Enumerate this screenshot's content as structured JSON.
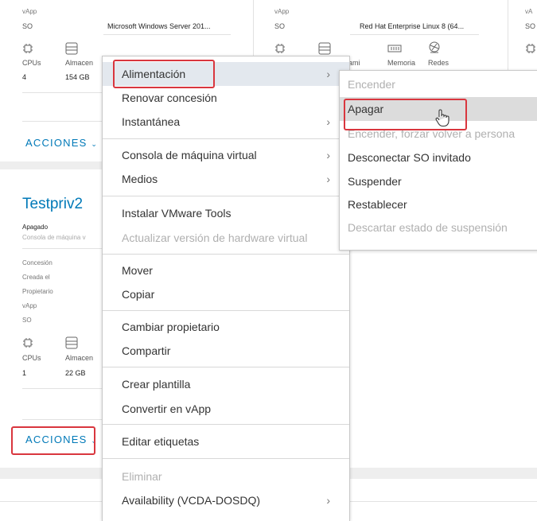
{
  "card1": {
    "label_top": "vApp",
    "so_label": "SO",
    "so_value": "Microsoft Windows Server 201...",
    "cpus_label": "CPUs",
    "storage_label": "Almacen",
    "cpus_value": "4",
    "storage_value": "154 GB",
    "acciones": "ACCIONES"
  },
  "card2": {
    "label_top": "vApp",
    "so_label": "SO",
    "so_value": "Red Hat Enterprise Linux 8 (64...",
    "memory_label": "Memoria",
    "network_label": "Redes",
    "cpus_label_cut": "ami"
  },
  "card3": {
    "so_label": "SO"
  },
  "testpriv2": {
    "title": "Testpriv2",
    "state": "Apagado",
    "console": "Consola de máquina v",
    "concesion": "Concesión",
    "creada": "Creada el",
    "propietario": "Propietario",
    "vapp": "vApp",
    "so": "SO",
    "cpus_label": "CPUs",
    "storage_label": "Almacen",
    "cpus_value": "1",
    "storage_value": "22 GB",
    "acciones": "ACCIONES"
  },
  "context_menu": {
    "items": [
      {
        "label": "Alimentación",
        "submenu": true,
        "disabled": false
      },
      {
        "label": "Renovar concesión",
        "submenu": false,
        "disabled": false
      },
      {
        "label": "Instantánea",
        "submenu": true,
        "disabled": false
      },
      {
        "label": "Consola de máquina virtual",
        "submenu": true,
        "disabled": false
      },
      {
        "label": "Medios",
        "submenu": true,
        "disabled": false
      },
      {
        "label": "Instalar VMware Tools",
        "submenu": false,
        "disabled": false
      },
      {
        "label": "Actualizar versión de hardware virtual",
        "submenu": false,
        "disabled": true
      },
      {
        "label": "Mover",
        "submenu": false,
        "disabled": false
      },
      {
        "label": "Copiar",
        "submenu": false,
        "disabled": false
      },
      {
        "label": "Cambiar propietario",
        "submenu": false,
        "disabled": false
      },
      {
        "label": "Compartir",
        "submenu": false,
        "disabled": false
      },
      {
        "label": "Crear plantilla",
        "submenu": false,
        "disabled": false
      },
      {
        "label": "Convertir en vApp",
        "submenu": false,
        "disabled": false
      },
      {
        "label": "Editar etiquetas",
        "submenu": false,
        "disabled": false
      },
      {
        "label": "Eliminar",
        "submenu": false,
        "disabled": true
      },
      {
        "label": "Availability (VCDA-DOSDQ)",
        "submenu": true,
        "disabled": false
      }
    ]
  },
  "power_submenu": {
    "items": [
      {
        "label": "Encender",
        "disabled": true
      },
      {
        "label": "Apagar",
        "disabled": false
      },
      {
        "label": "Encender, forzar volver a persona",
        "disabled": true
      },
      {
        "label": "Desconectar SO invitado",
        "disabled": false
      },
      {
        "label": "Suspender",
        "disabled": false
      },
      {
        "label": "Restablecer",
        "disabled": false
      },
      {
        "label": "Descartar estado de suspensión",
        "disabled": true
      }
    ]
  },
  "colors": {
    "accent": "#0079b8",
    "highlight_box": "#d9363e",
    "disabled_text": "#b0b0b0"
  }
}
